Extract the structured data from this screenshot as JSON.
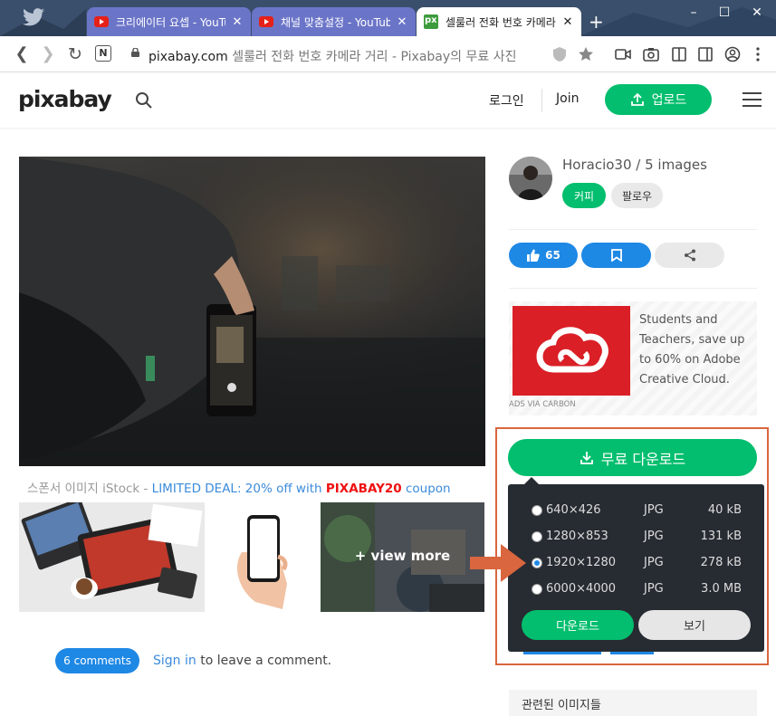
{
  "browser": {
    "tabs": [
      {
        "title": "크리에이터 요셉 - YouTube",
        "favicon": "youtube-icon"
      },
      {
        "title": "채널 맞춤설정 - YouTube",
        "favicon": "youtube-icon"
      },
      {
        "title": "셀룰러 전화 번호 카메라",
        "favicon": "pixabay-icon"
      }
    ],
    "new_tab_label": "+",
    "url_domain": "pixabay.com",
    "url_title": "셀룰러 전화 번호 카메라 거리 - Pixabay의 무료 사진",
    "n_badge": "N"
  },
  "header": {
    "logo": "pixabay",
    "login": "로그인",
    "join": "Join",
    "upload": "업로드"
  },
  "main": {
    "sponsor": {
      "prefix": "스폰서 이미지 iStock - ",
      "deal": "LIMITED DEAL: 20% off with ",
      "code": "PIXABAY20",
      "suffix": " coupon"
    },
    "view_more": "+ view more",
    "comments_badge": "6 comments",
    "signin_link": "Sign in",
    "signin_rest": " to leave a comment."
  },
  "sidebar": {
    "author": "Horacio30 / 5 images",
    "coffee": "커피",
    "follow": "팔로우",
    "likes": "65",
    "ad": {
      "text": "Students and Teachers, save up to 60% on Adobe Creative Cloud.",
      "via": "ADS VIA CARBON"
    },
    "download_button": "무료 다운로드",
    "download_options": [
      {
        "res": "640×426",
        "fmt": "JPG",
        "size": "40 kB",
        "selected": false
      },
      {
        "res": "1280×853",
        "fmt": "JPG",
        "size": "131 kB",
        "selected": false
      },
      {
        "res": "1920×1280",
        "fmt": "JPG",
        "size": "278 kB",
        "selected": true
      },
      {
        "res": "6000×4000",
        "fmt": "JPG",
        "size": "3.0 MB",
        "selected": false
      }
    ],
    "download_confirm": "다운로드",
    "view_button": "보기",
    "related_title": "관련된 이미지들"
  },
  "colors": {
    "green": "#02be6e",
    "blue": "#1e88e5",
    "highlight": "#d9663f",
    "panel": "#272b32",
    "adobe_red": "#da1f26"
  }
}
